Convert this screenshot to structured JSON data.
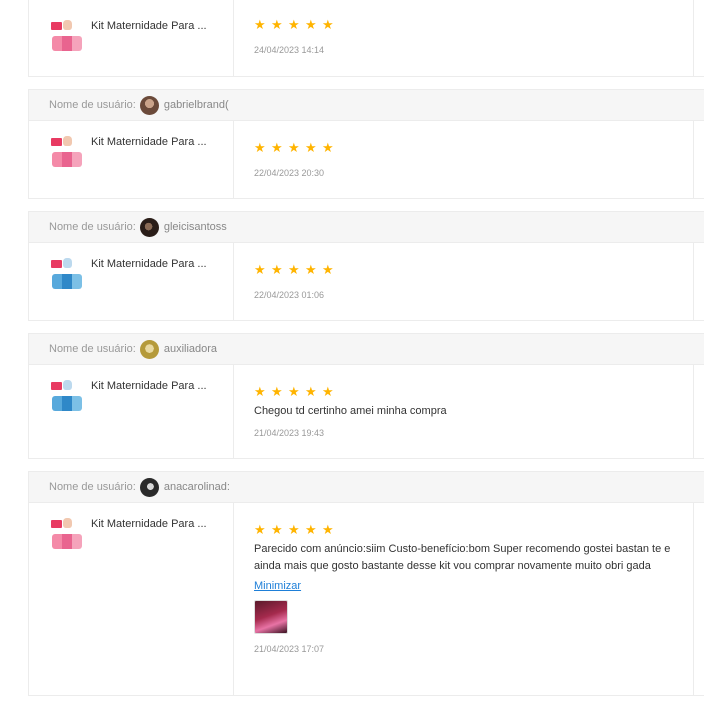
{
  "username_label": "Nome de usuário:",
  "reviews": [
    {
      "username": "",
      "product": "Kit Maternidade Para ...",
      "stars": 5,
      "comment": "",
      "date": "24/04/2023 14:14",
      "thumb_color": "pink"
    },
    {
      "username": "gabrielbrand(",
      "product": "Kit Maternidade Para ...",
      "stars": 5,
      "comment": "",
      "date": "22/04/2023 20:30",
      "thumb_color": "pink",
      "avatar_color": "#6b4a3a"
    },
    {
      "username": "gleicisantoss",
      "product": "Kit Maternidade Para ...",
      "stars": 5,
      "comment": "",
      "date": "22/04/2023 01:06",
      "thumb_color": "blue",
      "avatar_color": "#3b2a22"
    },
    {
      "username": "auxiliadora",
      "product": "Kit Maternidade Para ...",
      "stars": 5,
      "comment": "Chegou td certinho amei minha compra",
      "date": "21/04/2023 19:43",
      "thumb_color": "blue",
      "avatar_color": "#b59a3a"
    },
    {
      "username": "anacarolinad:",
      "product": "Kit Maternidade Para ...",
      "stars": 5,
      "comment": "Parecido com anúncio:siim Custo-benefício:bom Super recomendo gostei bastan te e ainda mais que gosto bastante desse kit vou comprar novamente muito obri gada",
      "link": "Minimizar",
      "date": "21/04/2023 17:07",
      "thumb_color": "pink",
      "avatar_color": "#2a2a2a"
    }
  ],
  "star_color": "#ffb400",
  "link_color": "#1e7fd8"
}
